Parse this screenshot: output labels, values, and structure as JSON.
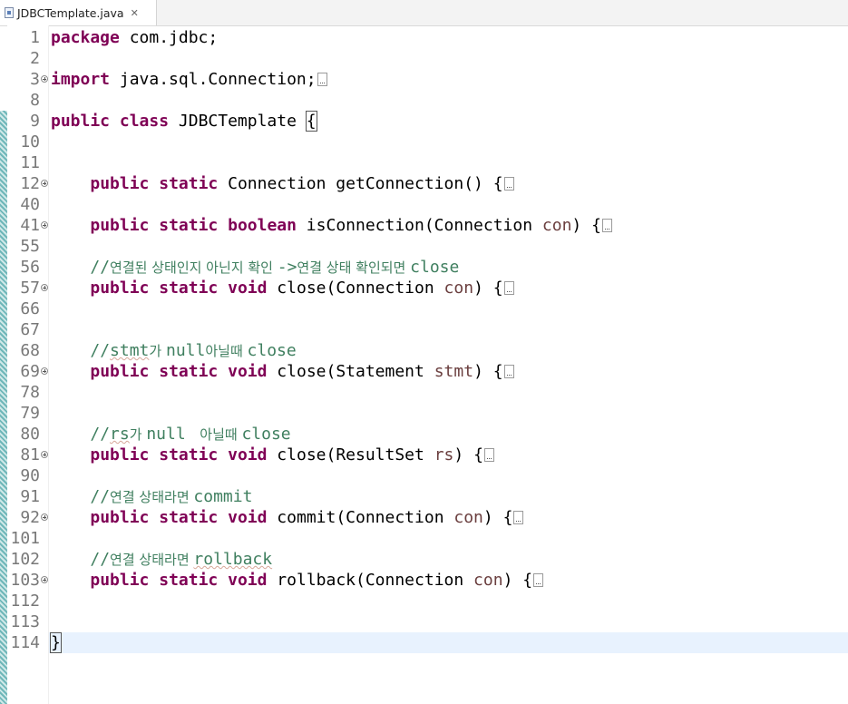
{
  "editor": {
    "tab_title": "JDBCTemplate.java",
    "tab_close": "✕"
  },
  "lines": [
    {
      "num": "1",
      "fold": false,
      "tokens": [
        {
          "t": "package",
          "c": "kw"
        },
        {
          "t": " com.jdbc;"
        }
      ]
    },
    {
      "num": "2",
      "fold": false,
      "tokens": []
    },
    {
      "num": "3",
      "fold": true,
      "tokens": [
        {
          "t": "import",
          "c": "kw"
        },
        {
          "t": " java.sql.Connection;"
        },
        {
          "collapsed": true
        }
      ]
    },
    {
      "num": "8",
      "fold": false,
      "tokens": []
    },
    {
      "num": "9",
      "fold": false,
      "tokens": [
        {
          "t": "public",
          "c": "kw"
        },
        {
          "t": " "
        },
        {
          "t": "class",
          "c": "kw"
        },
        {
          "t": " JDBCTemplate "
        },
        {
          "t": "{",
          "c": "bracket-box"
        }
      ]
    },
    {
      "num": "10",
      "fold": false,
      "tokens": []
    },
    {
      "num": "11",
      "fold": false,
      "tokens": []
    },
    {
      "num": "12",
      "fold": true,
      "tokens": [
        {
          "t": "    "
        },
        {
          "t": "public",
          "c": "kw"
        },
        {
          "t": " "
        },
        {
          "t": "static",
          "c": "kw"
        },
        {
          "t": " Connection getConnection() {"
        },
        {
          "collapsed": true
        }
      ]
    },
    {
      "num": "40",
      "fold": false,
      "tokens": []
    },
    {
      "num": "41",
      "fold": true,
      "tokens": [
        {
          "t": "    "
        },
        {
          "t": "public",
          "c": "kw"
        },
        {
          "t": " "
        },
        {
          "t": "static",
          "c": "kw"
        },
        {
          "t": " "
        },
        {
          "t": "boolean",
          "c": "kw"
        },
        {
          "t": " isConnection(Connection "
        },
        {
          "t": "con",
          "c": "var"
        },
        {
          "t": ") {"
        },
        {
          "collapsed": true
        }
      ]
    },
    {
      "num": "55",
      "fold": false,
      "tokens": []
    },
    {
      "num": "56",
      "fold": false,
      "tokens": [
        {
          "t": "    "
        },
        {
          "t": "//",
          "c": "cm"
        },
        {
          "t": "연결된 상태인지 아닌지 확인 ",
          "c": "cm ko"
        },
        {
          "t": "->",
          "c": "cm"
        },
        {
          "t": "연결 상태 확인되면 ",
          "c": "cm ko"
        },
        {
          "t": "close",
          "c": "cm"
        }
      ]
    },
    {
      "num": "57",
      "fold": true,
      "tokens": [
        {
          "t": "    "
        },
        {
          "t": "public",
          "c": "kw"
        },
        {
          "t": " "
        },
        {
          "t": "static",
          "c": "kw"
        },
        {
          "t": " "
        },
        {
          "t": "void",
          "c": "kw"
        },
        {
          "t": " close(Connection "
        },
        {
          "t": "con",
          "c": "var"
        },
        {
          "t": ") {"
        },
        {
          "collapsed": true
        }
      ]
    },
    {
      "num": "66",
      "fold": false,
      "tokens": []
    },
    {
      "num": "67",
      "fold": false,
      "tokens": []
    },
    {
      "num": "68",
      "fold": false,
      "tokens": [
        {
          "t": "    "
        },
        {
          "t": "//",
          "c": "cm"
        },
        {
          "t": "stmt",
          "c": "cm sq"
        },
        {
          "t": "가 ",
          "c": "cm ko"
        },
        {
          "t": "null",
          "c": "cm"
        },
        {
          "t": "아닐때 ",
          "c": "cm ko"
        },
        {
          "t": "close",
          "c": "cm"
        }
      ]
    },
    {
      "num": "69",
      "fold": true,
      "tokens": [
        {
          "t": "    "
        },
        {
          "t": "public",
          "c": "kw"
        },
        {
          "t": " "
        },
        {
          "t": "static",
          "c": "kw"
        },
        {
          "t": " "
        },
        {
          "t": "void",
          "c": "kw"
        },
        {
          "t": " close(Statement "
        },
        {
          "t": "stmt",
          "c": "var"
        },
        {
          "t": ") {"
        },
        {
          "collapsed": true
        }
      ]
    },
    {
      "num": "78",
      "fold": false,
      "tokens": []
    },
    {
      "num": "79",
      "fold": false,
      "tokens": []
    },
    {
      "num": "80",
      "fold": false,
      "tokens": [
        {
          "t": "    "
        },
        {
          "t": "//",
          "c": "cm"
        },
        {
          "t": "rs",
          "c": "cm sq"
        },
        {
          "t": "가 ",
          "c": "cm ko"
        },
        {
          "t": "null ",
          "c": "cm"
        },
        {
          "t": " 아닐때 ",
          "c": "cm ko"
        },
        {
          "t": "close",
          "c": "cm"
        }
      ]
    },
    {
      "num": "81",
      "fold": true,
      "tokens": [
        {
          "t": "    "
        },
        {
          "t": "public",
          "c": "kw"
        },
        {
          "t": " "
        },
        {
          "t": "static",
          "c": "kw"
        },
        {
          "t": " "
        },
        {
          "t": "void",
          "c": "kw"
        },
        {
          "t": " close(ResultSet "
        },
        {
          "t": "rs",
          "c": "var"
        },
        {
          "t": ") {"
        },
        {
          "collapsed": true
        }
      ]
    },
    {
      "num": "90",
      "fold": false,
      "tokens": []
    },
    {
      "num": "91",
      "fold": false,
      "tokens": [
        {
          "t": "    "
        },
        {
          "t": "//",
          "c": "cm"
        },
        {
          "t": "연결 상태라면 ",
          "c": "cm ko"
        },
        {
          "t": "commit",
          "c": "cm"
        }
      ]
    },
    {
      "num": "92",
      "fold": true,
      "tokens": [
        {
          "t": "    "
        },
        {
          "t": "public",
          "c": "kw"
        },
        {
          "t": " "
        },
        {
          "t": "static",
          "c": "kw"
        },
        {
          "t": " "
        },
        {
          "t": "void",
          "c": "kw"
        },
        {
          "t": " commit(Connection "
        },
        {
          "t": "con",
          "c": "var"
        },
        {
          "t": ") {"
        },
        {
          "collapsed": true
        }
      ]
    },
    {
      "num": "101",
      "fold": false,
      "tokens": []
    },
    {
      "num": "102",
      "fold": false,
      "tokens": [
        {
          "t": "    "
        },
        {
          "t": "//",
          "c": "cm"
        },
        {
          "t": "연결 상태라면 ",
          "c": "cm ko"
        },
        {
          "t": "rollback",
          "c": "cm sq"
        }
      ]
    },
    {
      "num": "103",
      "fold": true,
      "tokens": [
        {
          "t": "    "
        },
        {
          "t": "public",
          "c": "kw"
        },
        {
          "t": " "
        },
        {
          "t": "static",
          "c": "kw"
        },
        {
          "t": " "
        },
        {
          "t": "void",
          "c": "kw"
        },
        {
          "t": " rollback(Connection "
        },
        {
          "t": "con",
          "c": "var"
        },
        {
          "t": ") {"
        },
        {
          "collapsed": true
        }
      ]
    },
    {
      "num": "112",
      "fold": false,
      "tokens": []
    },
    {
      "num": "113",
      "fold": false,
      "tokens": []
    },
    {
      "num": "114",
      "fold": false,
      "tokens": [
        {
          "t": "}",
          "c": "bracket-box"
        },
        {
          "caret": true
        }
      ]
    }
  ]
}
